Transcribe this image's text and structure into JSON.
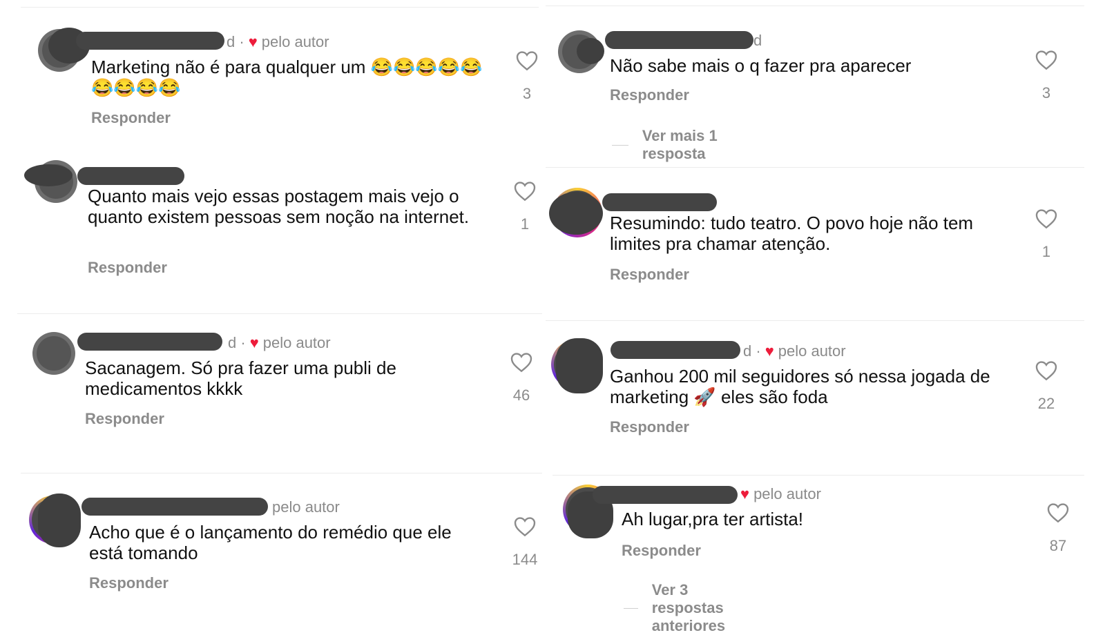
{
  "left_comments": [
    {
      "meta_suffix": "d ·",
      "author_badge": "pelo autor",
      "text": "Marketing não é para qualquer um 😂😂😂😂😂😂😂😂😂",
      "reply": "Responder",
      "likes": "3"
    },
    {
      "meta_suffix": "",
      "author_badge": "",
      "text": "Quanto mais vejo essas postagem mais vejo o quanto existem pessoas sem noção na internet.",
      "reply": "Responder",
      "likes": "1"
    },
    {
      "meta_suffix": "d ·",
      "author_badge": "pelo autor",
      "text": "Sacanagem. Só pra fazer uma publi de medicamentos  kkkk",
      "reply": "Responder",
      "likes": "46"
    },
    {
      "meta_suffix": "",
      "author_badge": "pelo autor",
      "text": "Acho que é o lançamento do remédio que ele está tomando",
      "reply": "Responder",
      "likes": "144"
    }
  ],
  "right_comments": [
    {
      "meta_suffix": "d",
      "author_badge": "",
      "text": "Não  sabe mais o q fazer pra aparecer",
      "reply": "Responder",
      "likes": "3",
      "more": "Ver mais 1 resposta"
    },
    {
      "meta_suffix": "",
      "author_badge": "",
      "text": "Resumindo: tudo teatro. O povo hoje não tem limites pra chamar atenção.",
      "reply": "Responder",
      "likes": "1"
    },
    {
      "meta_suffix": "d ·",
      "author_badge": "pelo autor",
      "text": "Ganhou 200 mil seguidores só nessa jogada de marketing 🚀 eles são foda",
      "reply": "Responder",
      "likes": "22"
    },
    {
      "meta_suffix": "",
      "author_badge": "pelo autor",
      "text": "Ah lugar,pra ter artista!",
      "reply": "Responder",
      "likes": "87",
      "more": "Ver 3 respostas anteriores"
    }
  ],
  "colors": {
    "heart_red": "#ed1c3b",
    "muted": "#8b8b8b",
    "redaction": "#444444"
  },
  "icons": {
    "like": "heart-outline-icon",
    "author_like": "heart-filled-icon"
  }
}
